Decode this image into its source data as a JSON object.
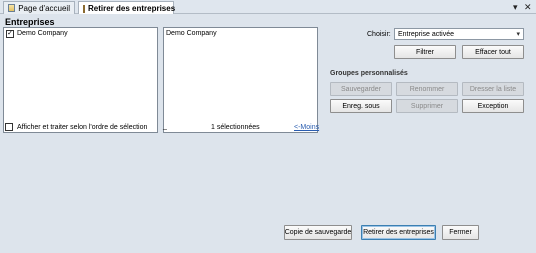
{
  "tabs": [
    {
      "label": "Page d'accueil",
      "icon": "home-page-icon"
    },
    {
      "label": "Retirer des entreprises",
      "icon": "remove-companies-icon",
      "active": true
    }
  ],
  "window_controls": {
    "dropdown": "▾",
    "close": "✕"
  },
  "section_title": "Entreprises",
  "left_list": {
    "items": [
      {
        "label": "Demo Company",
        "checked": true
      }
    ]
  },
  "right_list": {
    "items": [
      {
        "label": "Demo Company"
      }
    ]
  },
  "choose": {
    "label": "Choisir:",
    "selected": "Entreprise activée"
  },
  "buttons": {
    "filter": "Filtrer",
    "clear_all": "Effacer tout"
  },
  "groups": {
    "title": "Groupes personnalisés",
    "save": "Sauvegarder",
    "rename": "Renommer",
    "draw_list": "Dresser la liste",
    "save_as": "Enreg. sous",
    "delete": "Supprimer",
    "exception": "Exception"
  },
  "order_checkbox": {
    "label": "Afficher et traiter selon l'ordre de sélection",
    "checked": false
  },
  "status": {
    "underscore": "_",
    "selected_count": "1 sélectionnées",
    "less_link": "<-Moins"
  },
  "footer": {
    "backup": "Copie de sauvegarde",
    "remove": "Retirer des entreprises",
    "close": "Fermer"
  }
}
